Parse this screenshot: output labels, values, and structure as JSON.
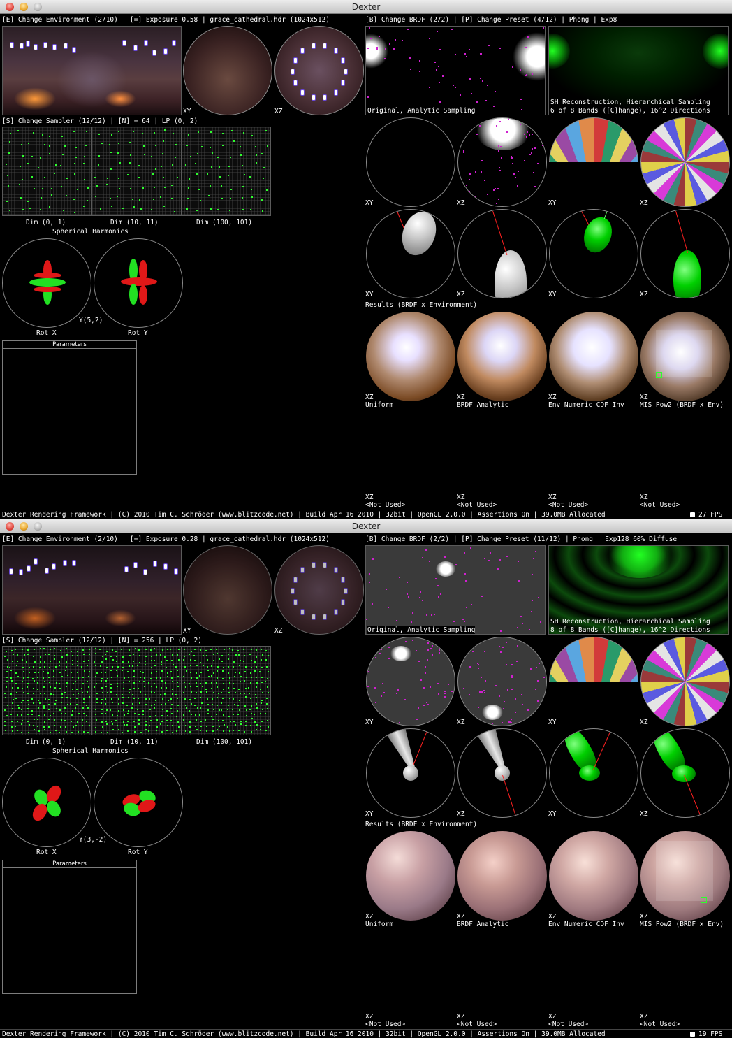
{
  "windows": [
    {
      "title": "Dexter",
      "env_header": "[E] Change Environment (2/10) | [=] Exposure 0.58 | grace_cathedral.hdr (1024x512)",
      "brdf_header": "[B] Change BRDF (2/2) | [P] Change Preset (4/12) | Phong | Exp8",
      "probe_labels": [
        "XY",
        "XZ"
      ],
      "brdf_original_label": "Original, Analytic Sampling",
      "sh_recon_line1": "SH Reconstruction, Hierarchical Sampling",
      "sh_recon_line2": "6 of 8 Bands ([C]hange), 16^2 Directions",
      "sampler_header": "[S] Change Sampler (12/12) | [N] = 64 | LP (0, 2)",
      "dims": [
        "Dim (0, 1)",
        "Dim (10, 11)",
        "Dim (100, 101)"
      ],
      "sh_title": "Spherical Harmonics",
      "sh_rot_x": "Rot X",
      "sh_rot_y": "Rot Y",
      "sh_label": "Y(5,2)",
      "parameters_title": "Parameters",
      "row2_labels": [
        "XY",
        "XZ",
        "XY",
        "XZ"
      ],
      "row3_labels": [
        "XY",
        "XZ",
        "XY",
        "XZ"
      ],
      "results_title": "Results (BRDF x Environment)",
      "results": [
        {
          "plane": "XZ",
          "name": "Uniform"
        },
        {
          "plane": "XZ",
          "name": "BRDF Analytic"
        },
        {
          "plane": "XZ",
          "name": "Env Numeric CDF Inv"
        },
        {
          "plane": "XZ",
          "name": "MIS Pow2 (BRDF x Env)"
        }
      ],
      "unused": [
        {
          "plane": "XZ",
          "name": "<Not Used>"
        },
        {
          "plane": "XZ",
          "name": "<Not Used>"
        },
        {
          "plane": "XZ",
          "name": "<Not Used>"
        },
        {
          "plane": "XZ",
          "name": "<Not Used>"
        }
      ],
      "status": "Dexter Rendering Framework | (C) 2010 Tim C. Schröder (www.blitzcode.net) | Build Apr 16 2010 | 32bit | OpenGL 2.0.0 | Assertions On | 39.0MB Allocated",
      "fps": "27 FPS"
    },
    {
      "title": "Dexter",
      "env_header": "[E] Change Environment (2/10) | [=] Exposure 0.28 | grace_cathedral.hdr (1024x512)",
      "brdf_header": "[B] Change BRDF (2/2) | [P] Change Preset (11/12) | Phong | Exp128 60% Diffuse",
      "probe_labels": [
        "XY",
        "XZ"
      ],
      "brdf_original_label": "Original, Analytic Sampling",
      "sh_recon_line1": "SH Reconstruction, Hierarchical Sampling",
      "sh_recon_line2": "8 of 8 Bands ([C]hange), 16^2 Directions",
      "sampler_header": "[S] Change Sampler (12/12) | [N] = 256 | LP (0, 2)",
      "dims": [
        "Dim (0, 1)",
        "Dim (10, 11)",
        "Dim (100, 101)"
      ],
      "sh_title": "Spherical Harmonics",
      "sh_rot_x": "Rot X",
      "sh_rot_y": "Rot Y",
      "sh_label": "Y(3,-2)",
      "parameters_title": "Parameters",
      "row2_labels": [
        "XY",
        "XZ",
        "XY",
        "XZ"
      ],
      "row3_labels": [
        "XY",
        "XZ",
        "XY",
        "XZ"
      ],
      "results_title": "Results (BRDF x Environment)",
      "results": [
        {
          "plane": "XZ",
          "name": "Uniform"
        },
        {
          "plane": "XZ",
          "name": "BRDF Analytic"
        },
        {
          "plane": "XZ",
          "name": "Env Numeric CDF Inv"
        },
        {
          "plane": "XZ",
          "name": "MIS Pow2 (BRDF x Env)"
        }
      ],
      "unused": [
        {
          "plane": "XZ",
          "name": "<Not Used>"
        },
        {
          "plane": "XZ",
          "name": "<Not Used>"
        },
        {
          "plane": "XZ",
          "name": "<Not Used>"
        },
        {
          "plane": "XZ",
          "name": "<Not Used>"
        }
      ],
      "status": "Dexter Rendering Framework | (C) 2010 Tim C. Schröder (www.blitzcode.net) | Build Apr 16 2010 | 32bit | OpenGL 2.0.0 | Assertions On | 39.0MB Allocated",
      "fps": "19 FPS"
    }
  ],
  "colors": {
    "sample_point": "#2eff2e",
    "sh_positive": "#22e022",
    "sh_negative": "#e01818",
    "direction_line": "#ff2020"
  },
  "icons": [
    "close-button-icon",
    "minimize-button-icon",
    "zoom-button-icon",
    "fps-indicator-icon"
  ]
}
